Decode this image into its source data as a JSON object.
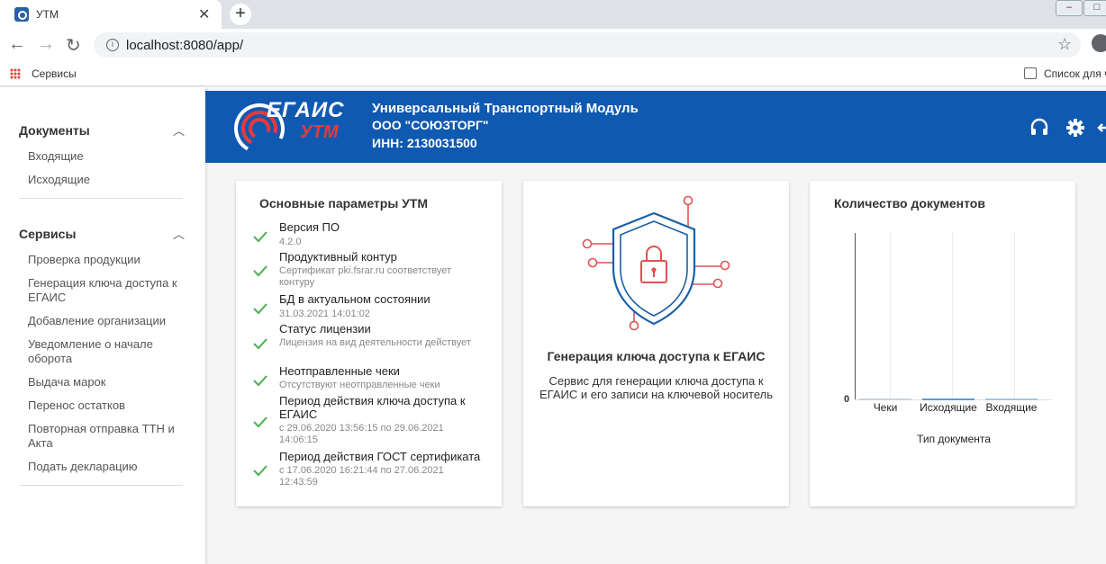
{
  "browser": {
    "tab_title": "УТМ",
    "tab_close": "✕",
    "new_tab": "+",
    "url": "localhost:8080/app/",
    "bookmark_apps_label": "Сервисы",
    "reading_list_label": "Список для ч",
    "window_minimize": "–",
    "window_maximize": "□"
  },
  "sidebar": {
    "sections": [
      {
        "title": "Документы",
        "items": [
          "Входящие",
          "Исходящие"
        ]
      },
      {
        "title": "Сервисы",
        "items": [
          "Проверка продукции",
          "Генерация ключа доступа к ЕГАИС",
          "Добавление организации",
          "Уведомление о начале оборота",
          "Выдача марок",
          "Перенос остатков",
          "Повторная отправка ТТН и Акта",
          "Подать декларацию"
        ]
      }
    ]
  },
  "header": {
    "logo_top": "ЕГАИС",
    "logo_bottom": "УТМ",
    "title": "Универсальный Транспортный Модуль",
    "org": "ООО \"СОЮЗТОРГ\"",
    "inn": "ИНН: 2130031500"
  },
  "params_card": {
    "title": "Основные параметры УТМ",
    "items": [
      {
        "label": "Версия ПО",
        "value": "4.2.0"
      },
      {
        "label": "Продуктивный контур",
        "value": "Сертификат pki.fsrar.ru соответствует контуру"
      },
      {
        "label": "БД в актуальном состоянии",
        "value": "31.03.2021 14:01:02"
      },
      {
        "label": "Статус лицензии",
        "value": "Лицензия на вид деятельности действует"
      },
      {
        "label": "Неотправленные чеки",
        "value": "Отсутствуют неотправленные чеки"
      },
      {
        "label": "Период действия ключа доступа к ЕГАИС",
        "value": "с 29.06.2020 13:56:15 по 29.06.2021 14:06:15"
      },
      {
        "label": "Период действия ГОСТ сертификата",
        "value": "с 17.06.2020 16:21:44 по 27.06.2021 12:43:59"
      }
    ]
  },
  "key_card": {
    "title": "Генерация ключа доступа к ЕГАИС",
    "description": "Сервис для генерации ключа доступа к ЕГАИС и его записи на ключевой носитель"
  },
  "docs_card": {
    "title": "Количество документов"
  },
  "chart_data": {
    "type": "bar",
    "title": "Количество документов",
    "xlabel": "Тип документа",
    "ylabel": "",
    "categories": [
      "Чеки",
      "Исходящие",
      "Входящие"
    ],
    "values": [
      0,
      0,
      0
    ],
    "y_ticks": [
      "0"
    ],
    "colors": [
      "#c9d3df",
      "#5b9bd5",
      "#9fc5e8"
    ]
  },
  "colors": {
    "header_blue": "#1059b0",
    "check_green": "#4caf50",
    "shield_blue": "#1a5fa8",
    "lock_red": "#e05252"
  }
}
